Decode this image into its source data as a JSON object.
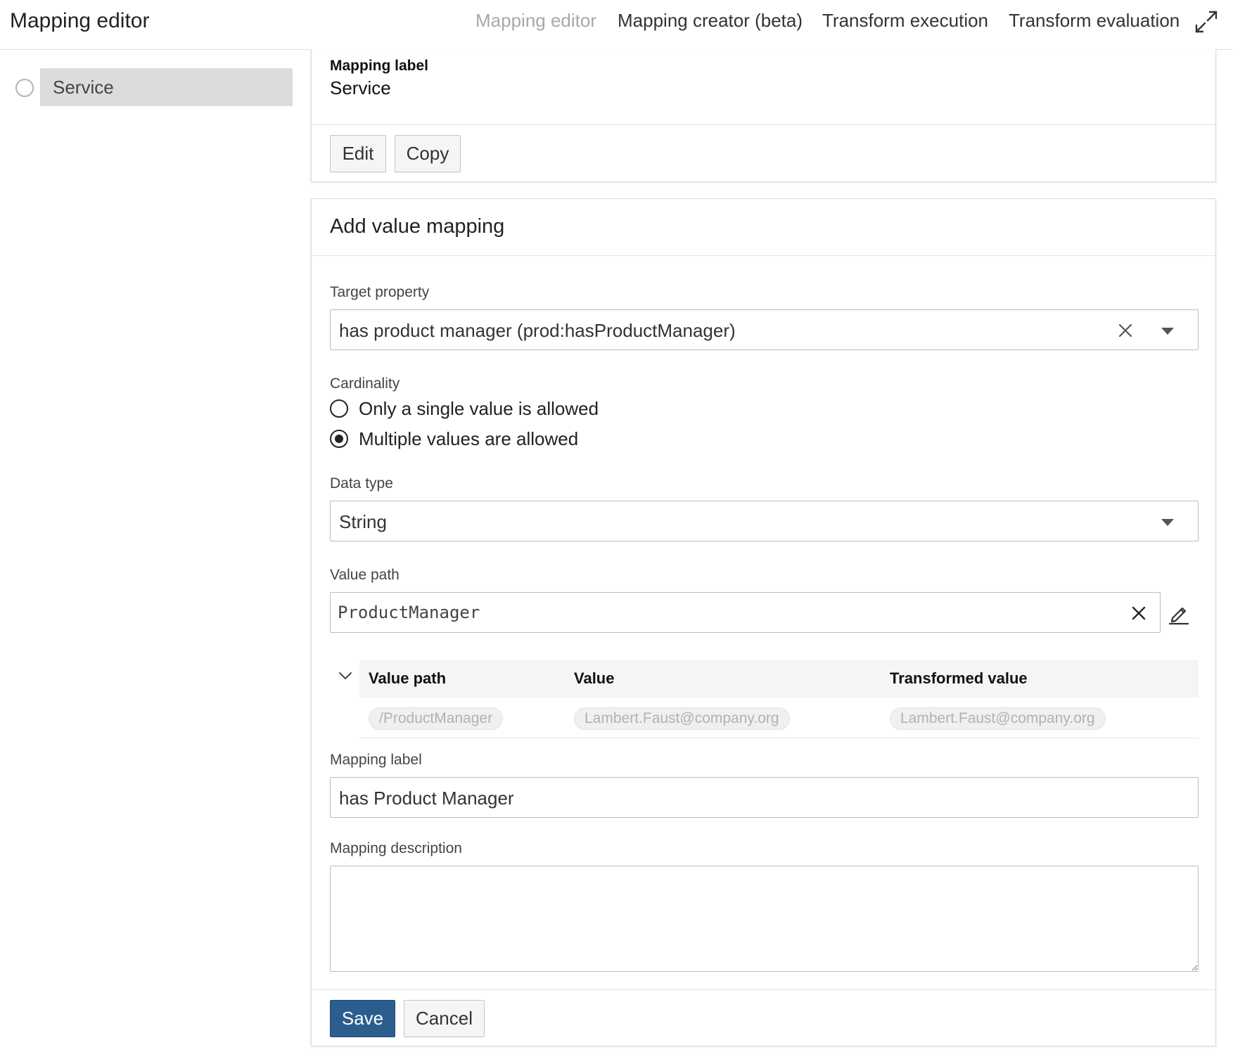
{
  "header": {
    "app_title": "Mapping editor",
    "tabs": [
      {
        "label": "Mapping editor",
        "active": true
      },
      {
        "label": "Mapping creator (beta)",
        "active": false
      },
      {
        "label": "Transform execution",
        "active": false
      },
      {
        "label": "Transform evaluation",
        "active": false
      }
    ],
    "expand_icon": "expand-icon"
  },
  "sidebar": {
    "items": [
      {
        "label": "Service"
      }
    ]
  },
  "mapping_card": {
    "label_title": "Mapping label",
    "label_value": "Service",
    "edit_label": "Edit",
    "copy_label": "Copy"
  },
  "form": {
    "title": "Add value mapping",
    "target_property": {
      "label": "Target property",
      "value": "has product manager (prod:hasProductManager)"
    },
    "cardinality": {
      "label": "Cardinality",
      "options": [
        {
          "label": "Only a single value is allowed",
          "checked": false
        },
        {
          "label": "Multiple values are allowed",
          "checked": true
        }
      ]
    },
    "data_type": {
      "label": "Data type",
      "value": "String"
    },
    "value_path": {
      "label": "Value path",
      "value": "ProductManager"
    },
    "preview_table": {
      "headers": [
        "Value path",
        "Value",
        "Transformed value"
      ],
      "rows": [
        [
          "/ProductManager",
          "Lambert.Faust@company.org",
          "Lambert.Faust@company.org"
        ]
      ]
    },
    "mapping_label": {
      "label": "Mapping label",
      "value": "has Product Manager"
    },
    "mapping_description": {
      "label": "Mapping description",
      "value": ""
    },
    "save_label": "Save",
    "cancel_label": "Cancel"
  },
  "colors": {
    "primary": "#2c5d8f",
    "sidebar_selected": "#dcdcdc",
    "active_tab": "#a8a8a8"
  }
}
